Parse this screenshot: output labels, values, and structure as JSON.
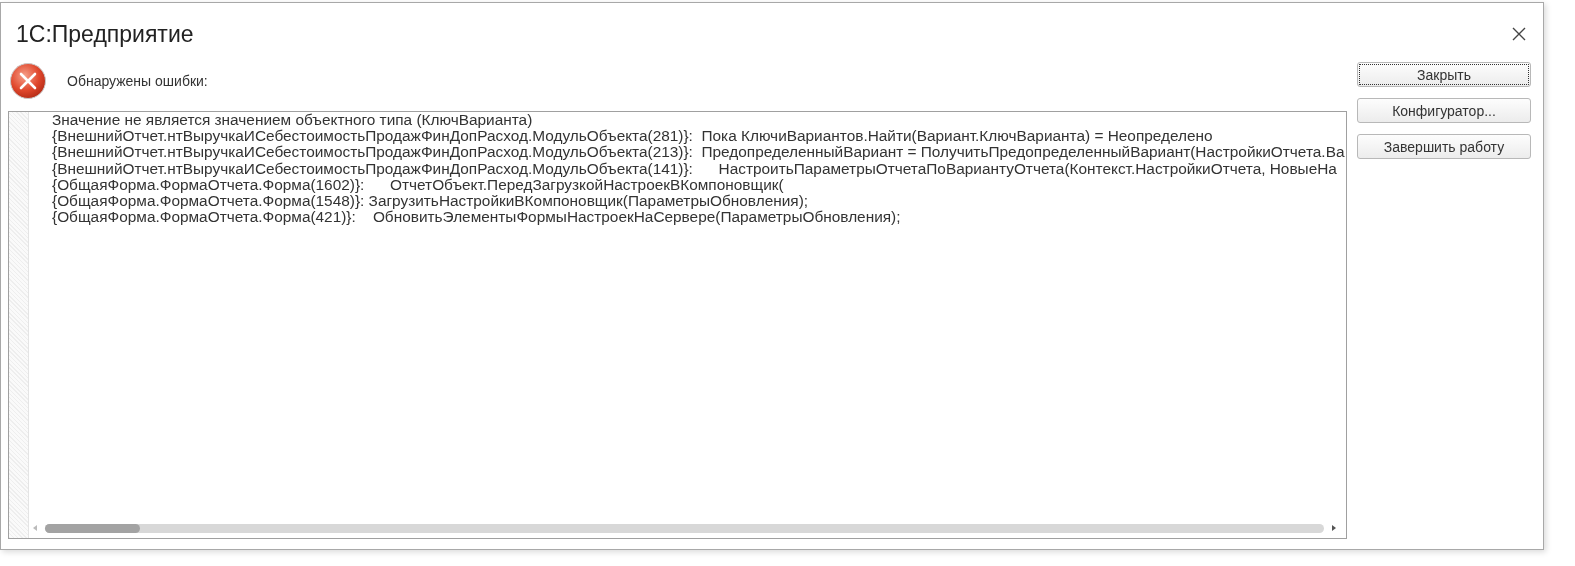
{
  "window": {
    "title": "1С:Предприятие"
  },
  "message": "Обнаружены ошибки:",
  "error_lines": [
    "Значение не является значением объектного типа (КлючВарианта)",
    "{ВнешнийОтчет.нтВыручкаИСебестоимостьПродажФинДопРасход.МодульОбъекта(281)}:  Пока КлючиВариантов.Найти(Вариант.КлючВарианта) = Неопределено",
    "{ВнешнийОтчет.нтВыручкаИСебестоимостьПродажФинДопРасход.МодульОбъекта(213)}:  ПредопределенныйВариант = ПолучитьПредопределенныйВариант(НастройкиОтчета.Ва",
    "{ВнешнийОтчет.нтВыручкаИСебестоимостьПродажФинДопРасход.МодульОбъекта(141)}:      НастроитьПараметрыОтчетаПоВариантуОтчета(Контекст.НастройкиОтчета, НовыеНа",
    "{ОбщаяФорма.ФормаОтчета.Форма(1602)}:      ОтчетОбъект.ПередЗагрузкойНастроекВКомпоновщик(",
    "{ОбщаяФорма.ФормаОтчета.Форма(1548)}: ЗагрузитьНастройкиВКомпоновщик(ПараметрыОбновления);",
    "{ОбщаяФорма.ФормаОтчета.Форма(421)}:    ОбновитьЭлементыФормыНастроекНаСервере(ПараметрыОбновления);"
  ],
  "buttons": [
    {
      "label": "Закрыть",
      "focused": true
    },
    {
      "label": "Конфигуратор...",
      "focused": false
    },
    {
      "label": "Завершить работу",
      "focused": false
    }
  ]
}
